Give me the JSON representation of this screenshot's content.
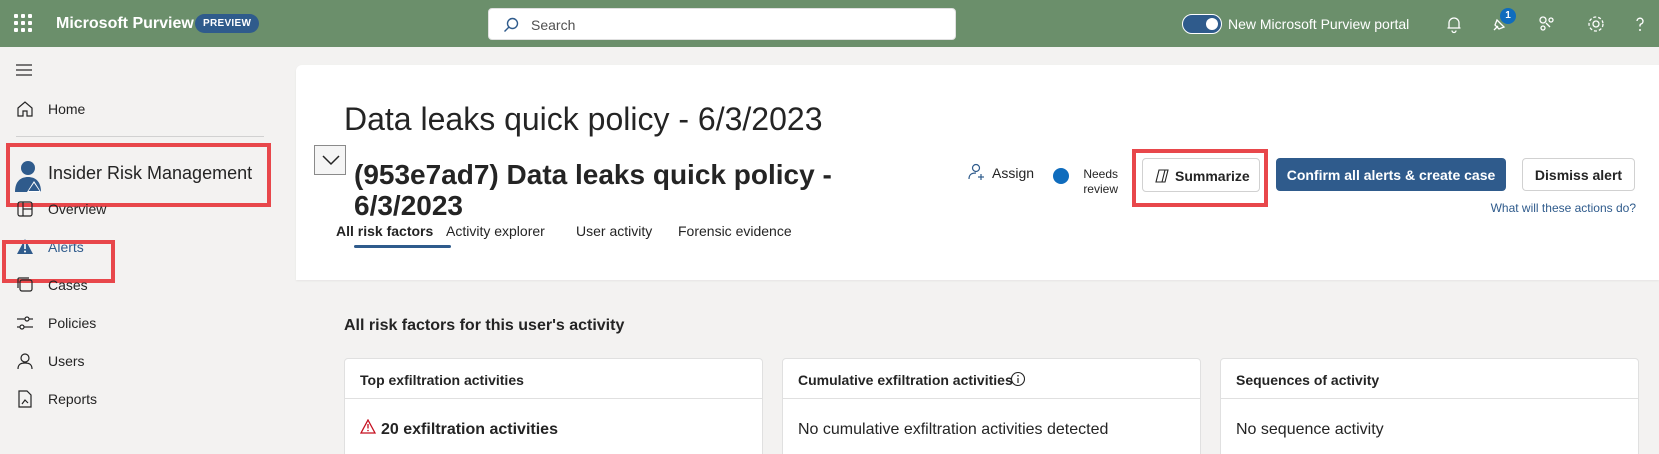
{
  "topbar": {
    "app_name": "Microsoft Purview",
    "badge": "PREVIEW",
    "search_placeholder": "Search",
    "portal_toggle_label": "New Microsoft Purview portal",
    "notification_count": "1"
  },
  "sidebar": {
    "home": "Home",
    "section": "Insider Risk Management",
    "items": [
      "Overview",
      "Alerts",
      "Cases",
      "Policies",
      "Users",
      "Reports"
    ]
  },
  "header": {
    "page_title": "Data leaks quick policy - 6/3/2023",
    "alert_title": "(953e7ad7) Data leaks quick policy - 6/3/2023",
    "assign": "Assign",
    "status": "Needs review",
    "summarize": "Summarize",
    "confirm": "Confirm all alerts & create case",
    "dismiss": "Dismiss alert",
    "actions_help": "What will these actions do?"
  },
  "tabs": [
    "All risk factors",
    "Activity explorer",
    "User activity",
    "Forensic evidence"
  ],
  "content": {
    "section_title": "All risk factors for this user's activity",
    "cards": [
      {
        "title": "Top exfiltration activities",
        "body": "20 exfiltration activities"
      },
      {
        "title": "Cumulative exfiltration activities",
        "body": "No cumulative exfiltration activities detected"
      },
      {
        "title": "Sequences of activity",
        "body": "No sequence activity"
      }
    ]
  },
  "colors": {
    "topbar": "#6b8f6b",
    "accent": "#2f5b8c",
    "highlight": "#e8474b"
  }
}
